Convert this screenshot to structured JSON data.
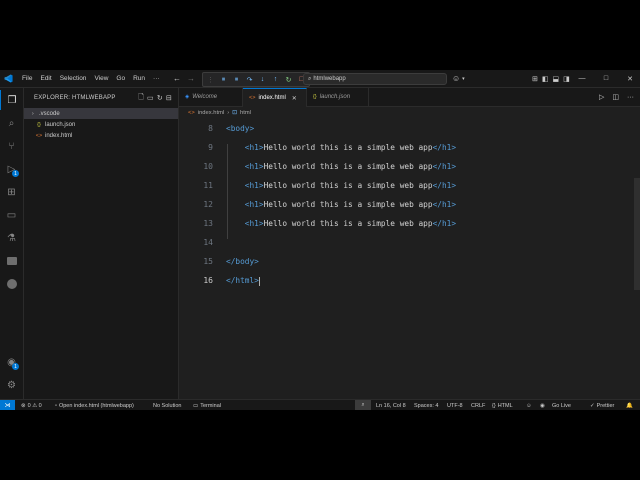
{
  "titlebar": {
    "menu": [
      "File",
      "Edit",
      "Selection",
      "View",
      "Go",
      "Run",
      "···"
    ],
    "search_text": "htmlwebapp",
    "debug_icons": [
      "pause-icon",
      "pause-icon",
      "step-over-icon",
      "step-into-icon",
      "step-out-icon",
      "restart-icon",
      "stop-icon"
    ]
  },
  "sidebar": {
    "title": "EXPLORER: HTMLWEBAPP",
    "items": [
      {
        "label": ".vscode",
        "type": "folder"
      },
      {
        "label": "launch.json",
        "icon": "{}"
      },
      {
        "label": "index.html",
        "icon": "<>"
      }
    ]
  },
  "tabs": [
    {
      "label": "Welcome"
    },
    {
      "label": "index.html",
      "active": true
    },
    {
      "label": "launch.json"
    }
  ],
  "breadcrumb": [
    "index.html",
    "html"
  ],
  "editor": {
    "lines": [
      {
        "n": "8",
        "indent": "",
        "open": "<body>",
        "text": "",
        "close": ""
      },
      {
        "n": "9",
        "indent": "    ",
        "open": "<h1>",
        "text": "Hello world this is a simple web app",
        "close": "</h1>"
      },
      {
        "n": "10",
        "indent": "    ",
        "open": "<h1>",
        "text": "Hello world this is a simple web app",
        "close": "</h1>"
      },
      {
        "n": "11",
        "indent": "    ",
        "open": "<h1>",
        "text": "Hello world this is a simple web app",
        "close": "</h1>"
      },
      {
        "n": "12",
        "indent": "    ",
        "open": "<h1>",
        "text": "Hello world this is a simple web app",
        "close": "</h1>"
      },
      {
        "n": "13",
        "indent": "    ",
        "open": "<h1>",
        "text": "Hello world this is a simple web app",
        "close": "</h1>"
      },
      {
        "n": "14",
        "indent": "",
        "open": "",
        "text": "",
        "close": ""
      },
      {
        "n": "15",
        "indent": "",
        "open": "</body>",
        "text": "",
        "close": ""
      },
      {
        "n": "16",
        "indent": "",
        "open": "</html>",
        "text": "",
        "close": ""
      }
    ]
  },
  "statusbar": {
    "problems": "0 ⚠ 0",
    "open": "Open index.html (htmlwebapp)",
    "solution": "No Solution",
    "terminal": "Terminal",
    "position": "Ln 16, Col 8",
    "spaces": "Spaces: 4",
    "encoding": "UTF-8",
    "eol": "CRLF",
    "language": "HTML",
    "golive": "Go Live",
    "prettier": "Prettier"
  },
  "colors": {
    "accent": "#0078d4",
    "tag": "#569cd6",
    "text": "#d4d4d4"
  }
}
